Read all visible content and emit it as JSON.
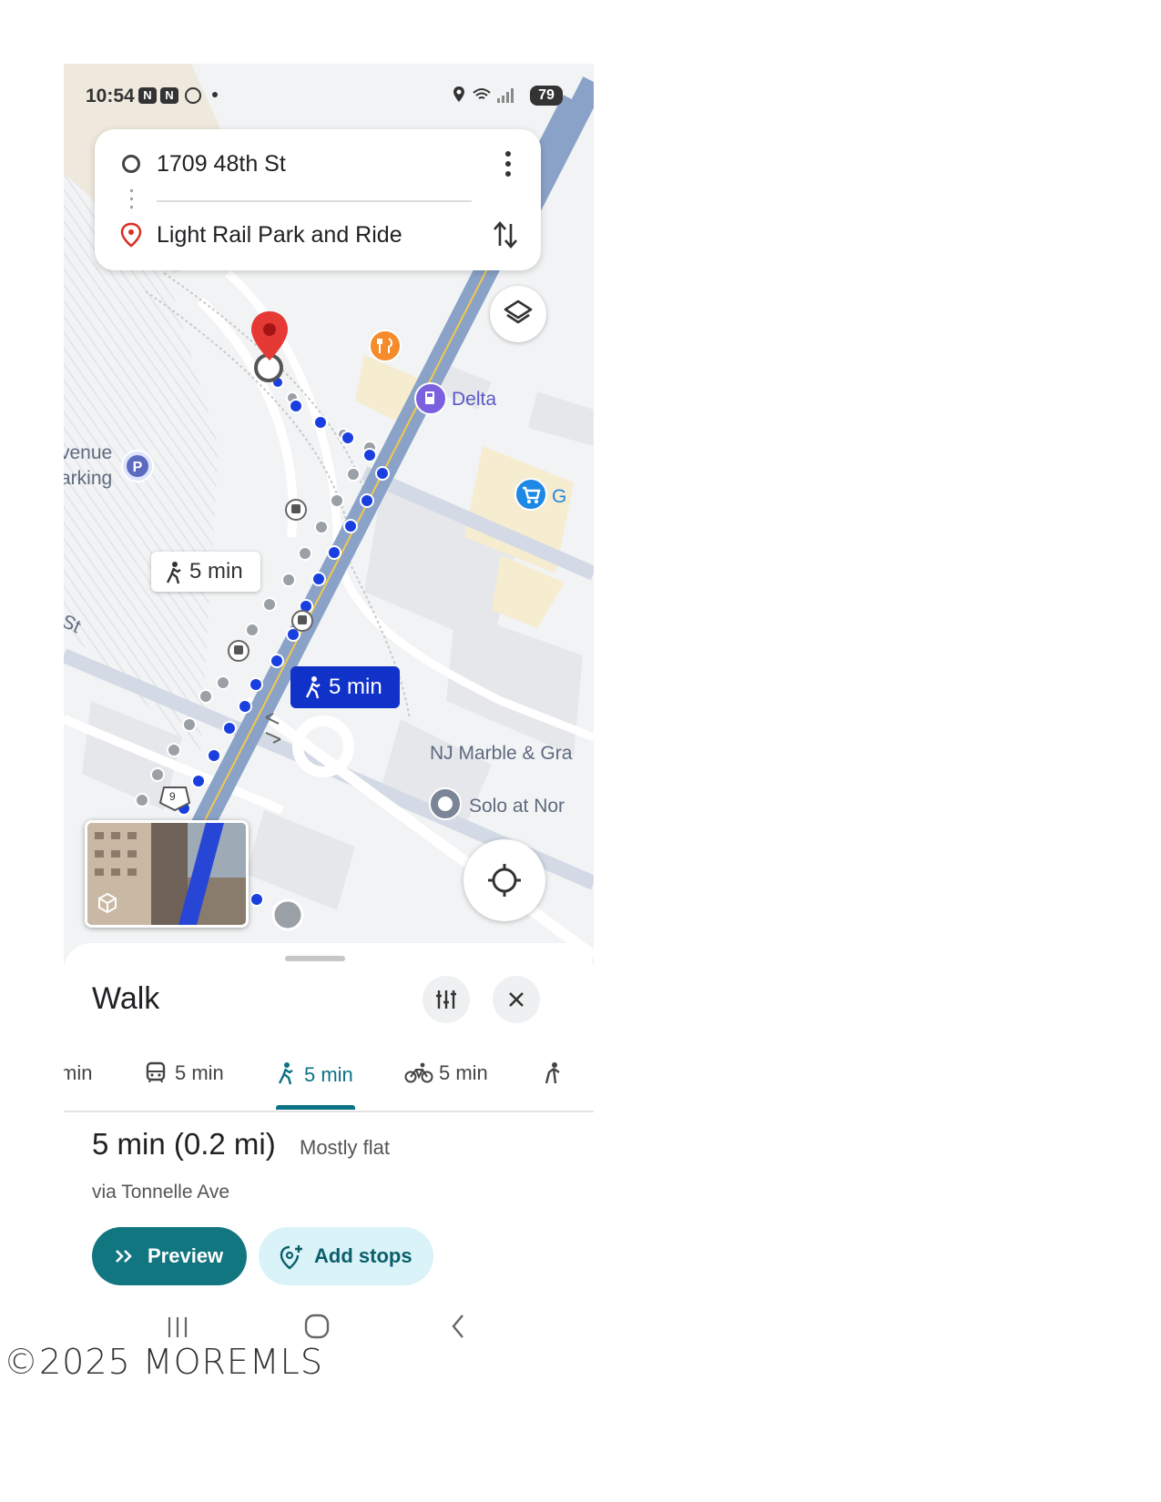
{
  "status_bar": {
    "time": "10:54",
    "battery": "79"
  },
  "directions": {
    "origin": "1709 48th St",
    "destination": "Light Rail Park and Ride"
  },
  "map": {
    "labels": {
      "delta": "Delta",
      "g_store": "G",
      "avenue": "venue",
      "parking": "arking",
      "st": "St",
      "nj_marble": "NJ Marble & Gra",
      "solo": "Solo at Nor",
      "route_shield": "9"
    },
    "walk_chip_alt": "5 min",
    "walk_chip_selected": "5 min"
  },
  "sheet": {
    "title": "Walk",
    "tabs": [
      {
        "label": "min",
        "icon": "car-icon"
      },
      {
        "label": "5 min",
        "icon": "transit-icon"
      },
      {
        "label": "5 min",
        "icon": "walk-icon",
        "active": true
      },
      {
        "label": "5 min",
        "icon": "bike-icon"
      },
      {
        "label": "",
        "icon": "rideshare-icon"
      }
    ],
    "summary": {
      "time_distance": "5 min (0.2 mi)",
      "terrain": "Mostly flat",
      "via": "via Tonnelle Ave"
    },
    "buttons": {
      "preview": "Preview",
      "add_stops": "Add stops"
    }
  },
  "watermark": "©2025 MOREMLS",
  "colors": {
    "route_blue": "#1a3fe0",
    "accent_teal": "#127681",
    "destination_red": "#e53935"
  }
}
